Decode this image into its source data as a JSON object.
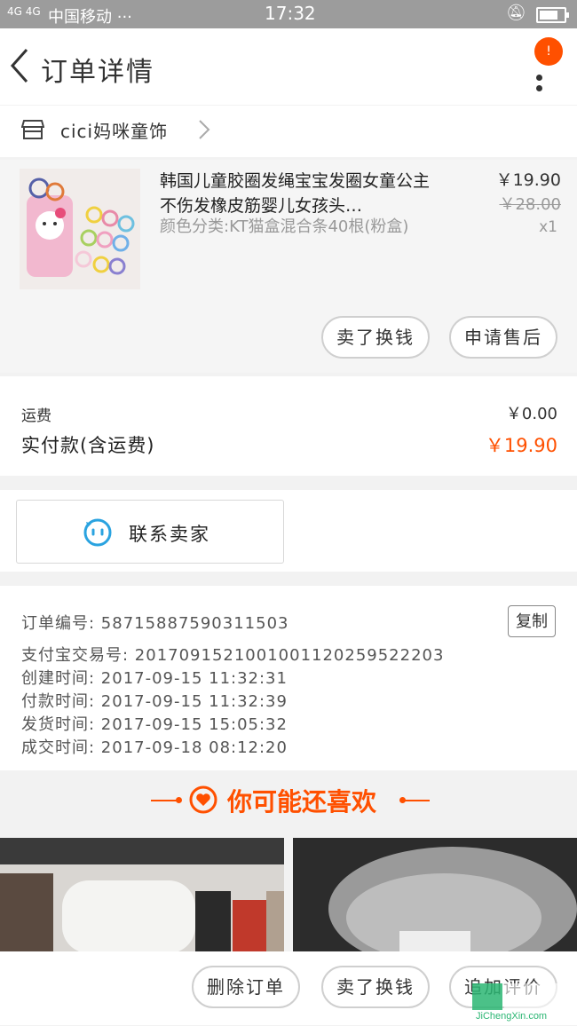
{
  "status_bar": {
    "signal": "4G 4G",
    "carrier": "中国移动 ···",
    "time": "17:32"
  },
  "header": {
    "title": "订单详情",
    "badge": "!"
  },
  "shop": {
    "name": "cici妈咪童饰"
  },
  "product": {
    "title": "韩国儿童胶圈发绳宝宝发圈女童公主不伤发橡皮筋婴儿女孩头…",
    "sku": "颜色分类:KT猫盒混合条40根(粉盒)",
    "price": "￥19.90",
    "original_price": "￥28.00",
    "quantity": "x1",
    "actions": [
      "卖了换钱",
      "申请售后"
    ]
  },
  "summary": {
    "freight_label": "运费",
    "freight_value": "￥0.00",
    "total_label": "实付款(含运费)",
    "total_value": "￥19.90",
    "accent_color": "#ff5000"
  },
  "contact": {
    "label": "联系卖家"
  },
  "order_info": {
    "order_no": "订单编号: 58715887590311503",
    "alipay_no": "支付宝交易号: 2017091521001001120259522203",
    "created": "创建时间: 2017-09-15 11:32:31",
    "paid": "付款时间: 2017-09-15 11:32:39",
    "shipped": "发货时间: 2017-09-15 15:05:32",
    "completed": "成交时间: 2017-09-18 08:12:20",
    "copy_label": "复制"
  },
  "recommend": {
    "title": "你可能还喜欢"
  },
  "bottom_bar": {
    "delete": "删除订单",
    "sell": "卖了换钱",
    "review": "追加评价"
  },
  "watermark": {
    "text": "JiChengXin.com"
  }
}
